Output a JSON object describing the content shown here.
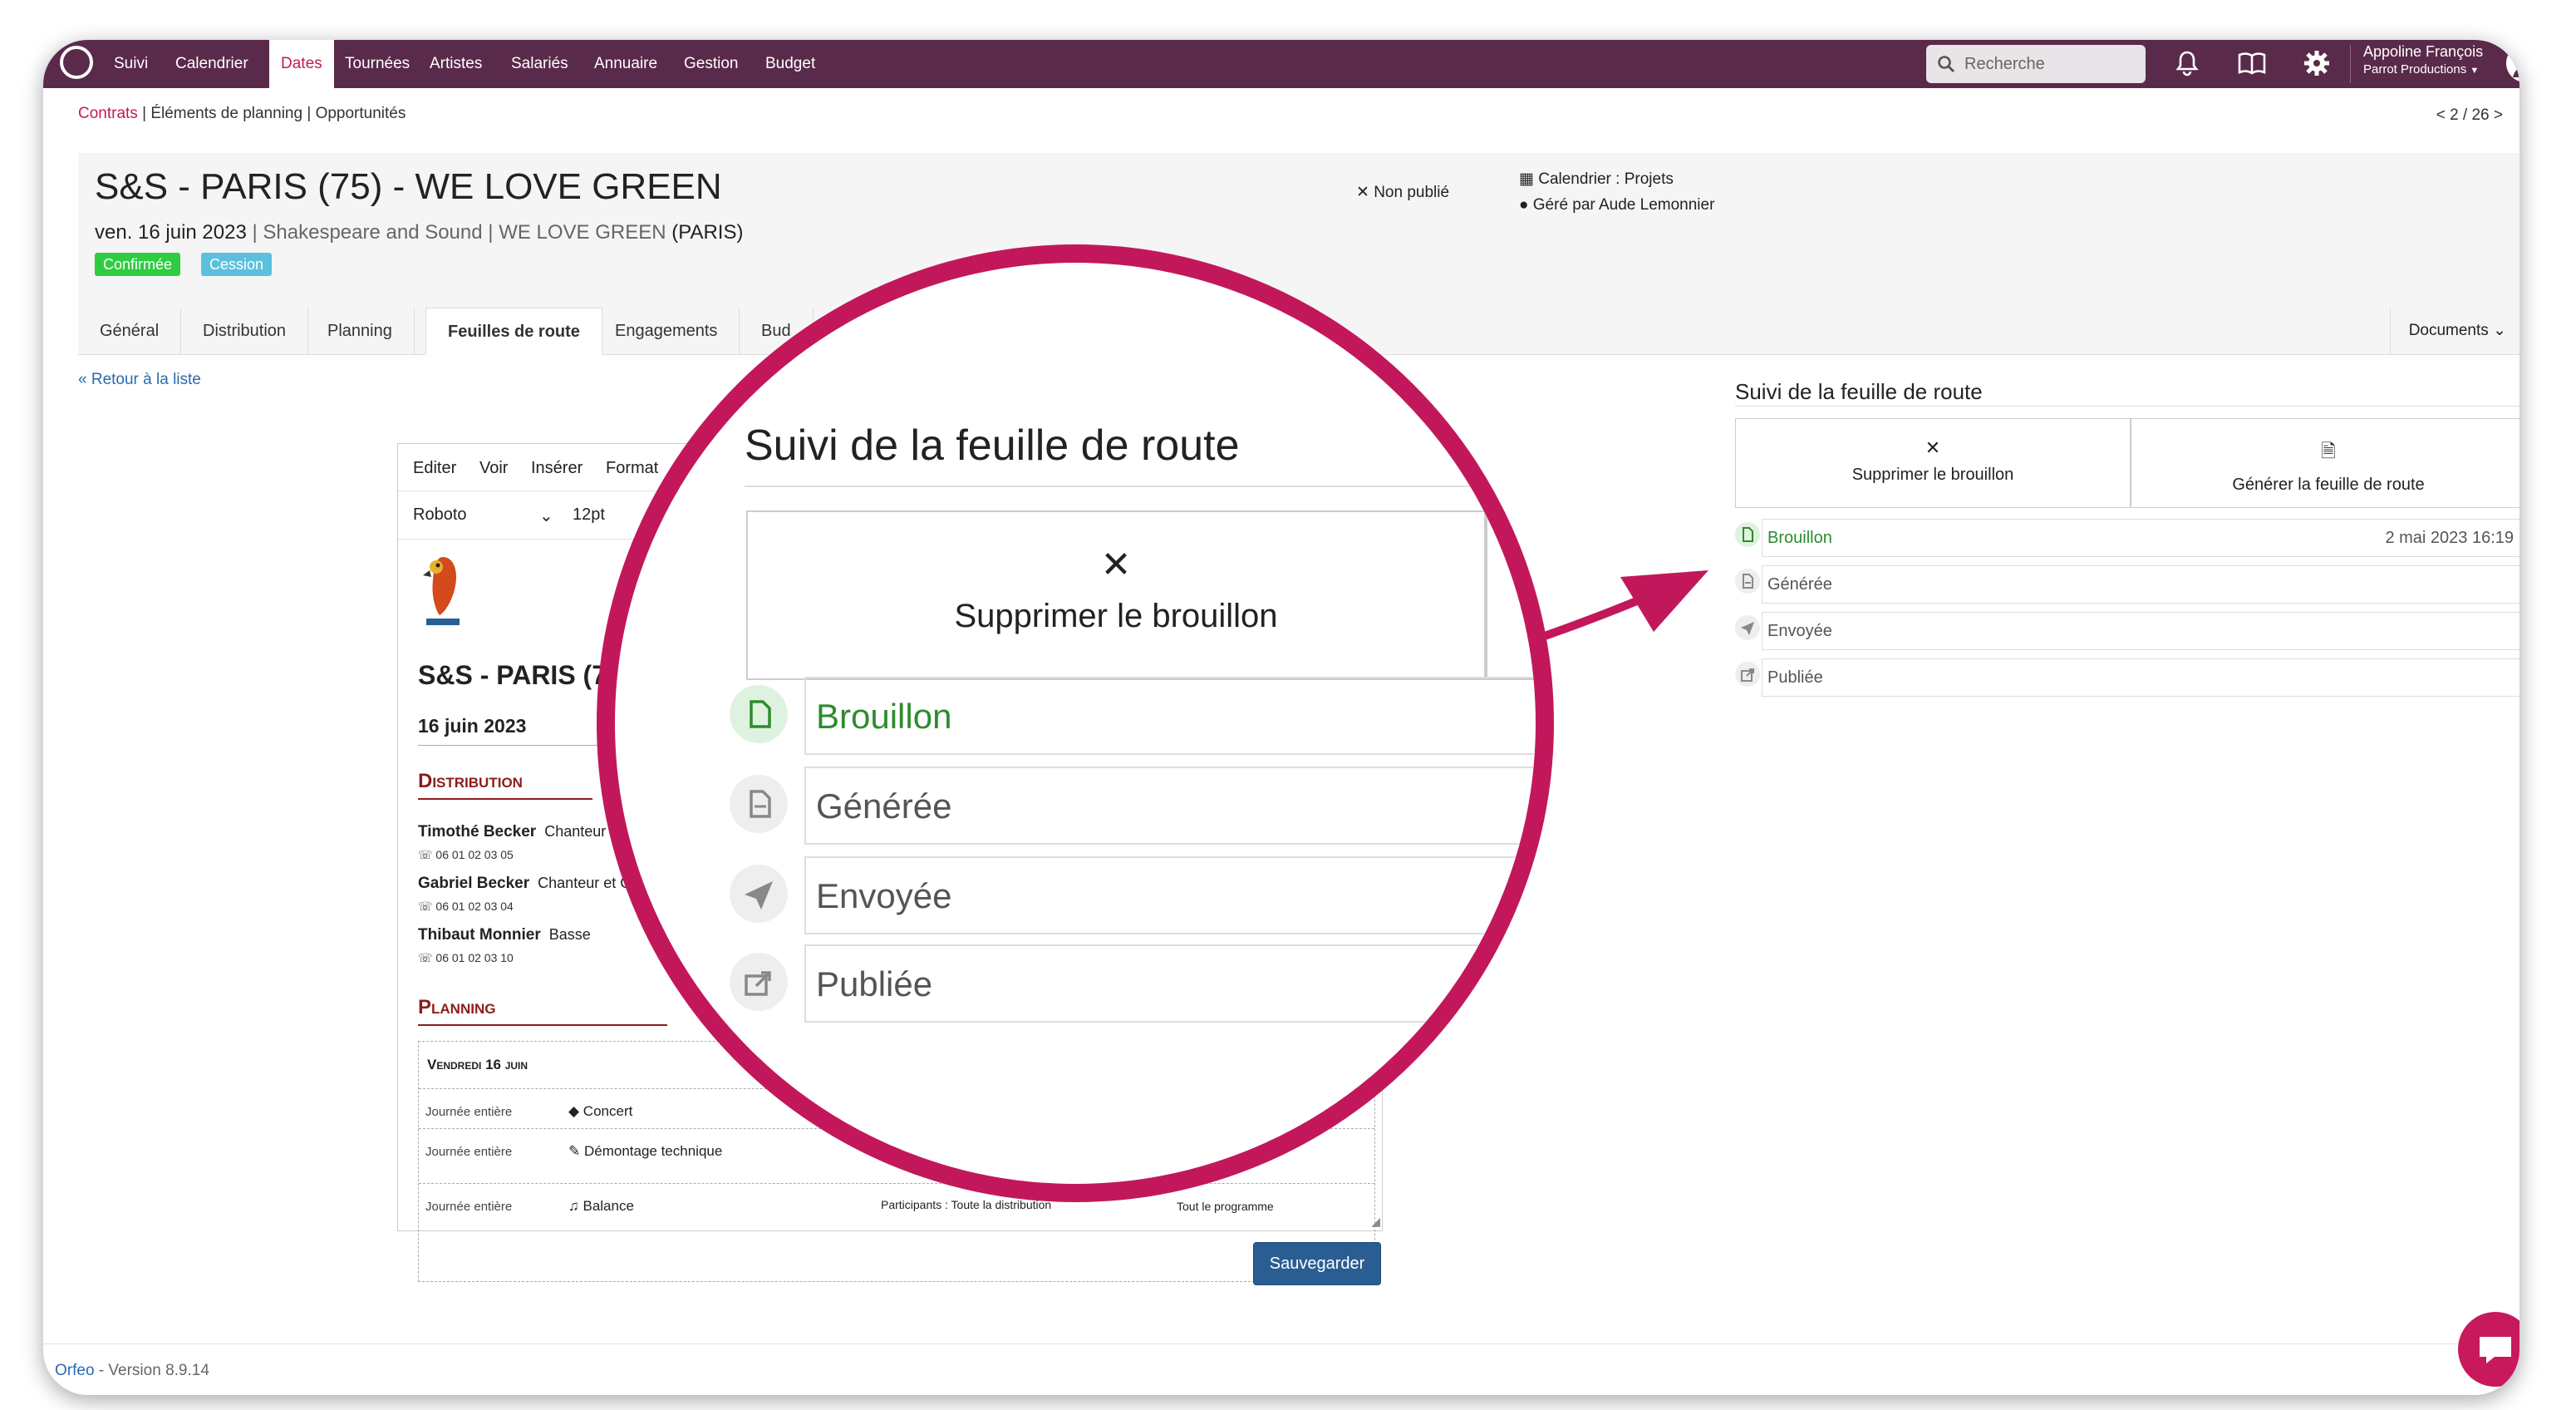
{
  "nav": {
    "items": [
      "Suivi",
      "Calendrier",
      "Dates",
      "Tournées",
      "Artistes",
      "Salariés",
      "Annuaire",
      "Gestion",
      "Budget"
    ],
    "active": "Dates",
    "search_placeholder": "Recherche",
    "user_name": "Appoline François",
    "user_org": "Parrot Productions"
  },
  "breadcrumb": {
    "first": "Contrats",
    "sep1": " | ",
    "second": "Éléments de planning",
    "sep2": " | ",
    "third": "Opportunités"
  },
  "pager": "< 2 / 26 >",
  "header": {
    "title": "S&S - PARIS (75) - WE LOVE GREEN",
    "date": "ven. 16 juin 2023",
    "sep": " | ",
    "company": "Shakespeare and Sound",
    "sep2": " | ",
    "venue": "WE LOVE GREEN",
    "city": " (PARIS)",
    "badge_confirmed": "Confirmée",
    "badge_cession": "Cession",
    "calendar": "Calendrier : Projets",
    "managed_by": "Géré par Aude Lemonnier",
    "unpublished": "Non publié",
    "colors": {
      "confirmed": "#2ecc40",
      "cession": "#5bc0de",
      "accent": "#c2185b",
      "nav": "#5a2a4a"
    }
  },
  "tabs": [
    "Général",
    "Distribution",
    "Planning",
    "Feuilles de route",
    "Engagements",
    "Budget"
  ],
  "tabs_visible": [
    "Général",
    "Distribution",
    "Planning",
    "Feuilles de route",
    "Engagements",
    "Bud"
  ],
  "active_tab": "Feuilles de route",
  "documents_label": "Documents",
  "back_link": "« Retour à la liste",
  "editor": {
    "menu": [
      "Editer",
      "Voir",
      "Insérer",
      "Format"
    ],
    "font": "Roboto",
    "size": "12pt",
    "doc_title": "S&S - PARIS (7",
    "doc_date": "16 juin 2023",
    "section_distribution": "Distribution",
    "people": [
      {
        "name": "Timothé Becker",
        "role": "Chanteur",
        "phone": "06 01 02 03 05"
      },
      {
        "name": "Gabriel Becker",
        "role": "Chanteur et G",
        "phone": "06 01 02 03 04"
      },
      {
        "name": "Thibaut Monnier",
        "role": "Basse",
        "phone": "06 01 02 03 10"
      }
    ],
    "section_planning": "Planning",
    "day": "Vendredi 16 juin",
    "rows": [
      {
        "when": "Journée entière",
        "what": "Concert"
      },
      {
        "when": "Journée entière",
        "what": "Démontage technique"
      },
      {
        "when": "Journée entière",
        "what": "Balance"
      }
    ],
    "participants": "Participants : Toute la distribution",
    "programme": "Tout le programme",
    "save_label": "Sauvegarder"
  },
  "roadmap": {
    "title": "Suivi de la feuille de route",
    "delete_draft": "Supprimer le brouillon",
    "generate": "Générer la feuille de route",
    "statuses": [
      {
        "label": "Brouillon",
        "date": "2 mai 2023 16:19",
        "active": true
      },
      {
        "label": "Générée",
        "date": "",
        "active": false
      },
      {
        "label": "Envoyée",
        "date": "",
        "active": false
      },
      {
        "label": "Publiée",
        "date": "",
        "active": false
      }
    ]
  },
  "footer": {
    "brand": "Orfeo",
    "version": " - Version 8.9.14"
  }
}
